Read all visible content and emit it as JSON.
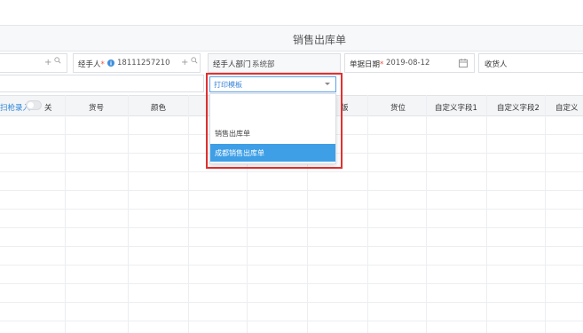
{
  "header": {
    "title": "销售出库单"
  },
  "form": {
    "handler": {
      "label": "经手人",
      "required_mark": "*",
      "value": "18111257210"
    },
    "department": {
      "label": "经手人部门",
      "value": "系统部"
    },
    "date": {
      "label": "单据日期",
      "required_mark": "*",
      "value": "2019-08-12"
    },
    "receiver": {
      "label": "收货人"
    }
  },
  "print_template": {
    "placeholder": "打印模板",
    "options": [
      "销售出库单",
      "成都销售出库单"
    ],
    "highlighted_index": 1
  },
  "table": {
    "toggle_label": "扫枪录入",
    "toggle_state": "关",
    "columns": [
      "货号",
      "颜色",
      "货位",
      "自定义字段1",
      "自定义字段2",
      "自定义"
    ],
    "partial_column_text": "版"
  },
  "colors": {
    "accent": "#3f9fe6",
    "highlight_border": "#e2302f"
  }
}
